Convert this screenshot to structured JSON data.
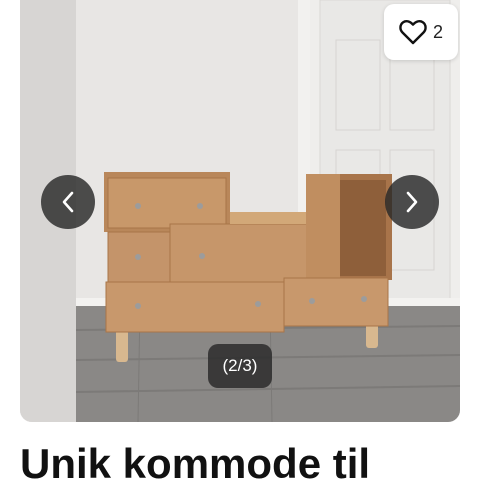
{
  "listing": {
    "title": "Unik kommode til",
    "favorites_count": "2",
    "image_counter": "(2/3)"
  },
  "icons": {
    "favorite": "heart-outline-icon",
    "previous": "chevron-left-icon",
    "next": "chevron-right-icon"
  },
  "colors": {
    "overlay": "#282828",
    "wood": "#c49a6c"
  }
}
